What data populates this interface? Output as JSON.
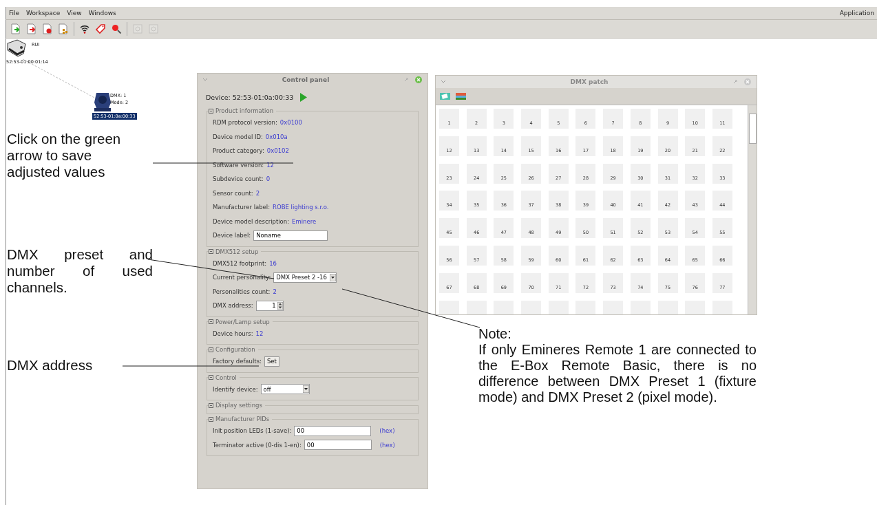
{
  "menu": [
    {
      "label": "File"
    },
    {
      "label": "Workspace"
    },
    {
      "label": "View"
    },
    {
      "label": "Windows"
    }
  ],
  "menu_right": "Application",
  "toolbar": [
    {
      "kind": "doc-in",
      "disabled": false
    },
    {
      "kind": "doc-out",
      "disabled": false
    },
    {
      "kind": "doc-remove",
      "disabled": false
    },
    {
      "kind": "doc-grid",
      "disabled": false
    },
    {
      "kind": "sep"
    },
    {
      "kind": "wifi",
      "disabled": false
    },
    {
      "kind": "tag",
      "disabled": false
    },
    {
      "kind": "search",
      "disabled": false
    },
    {
      "kind": "sep"
    },
    {
      "kind": "box",
      "disabled": true
    },
    {
      "kind": "box",
      "disabled": true
    }
  ],
  "canvas": {
    "controller": {
      "name": "RUI",
      "uid": "52:53-01:00:01:14"
    },
    "fixture": {
      "dmx": "DMX: 1",
      "mode": "Mode: 2",
      "uid": "52:53-01:0a:00:33",
      "selected": true
    }
  },
  "control_panel": {
    "title": "Control panel",
    "device": "Device: 52:53-01:0a:00:33",
    "groups": [
      {
        "title": "Product information",
        "rows": [
          {
            "kind": "value",
            "label": "RDM protocol version:",
            "value": "0x0100"
          },
          {
            "kind": "value",
            "label": "Device model ID:",
            "value": "0x010a"
          },
          {
            "kind": "value",
            "label": "Product category:",
            "value": "0x0102"
          },
          {
            "kind": "value",
            "label": "Software version:",
            "value": "12"
          },
          {
            "kind": "value",
            "label": "Subdevice count:",
            "value": "0"
          },
          {
            "kind": "value",
            "label": "Sensor count:",
            "value": "2"
          },
          {
            "kind": "value",
            "label": "Manufacturer label:",
            "value": "ROBE lighting s.r.o."
          },
          {
            "kind": "value",
            "label": "Device model description:",
            "value": "Eminere"
          },
          {
            "kind": "input",
            "label": "Device label:",
            "value": "Noname"
          }
        ]
      },
      {
        "title": "DMX512 setup",
        "rows": [
          {
            "kind": "value",
            "label": "DMX512 footprint:",
            "value": "16"
          },
          {
            "kind": "select",
            "label": "Current personality:",
            "value": "DMX Preset 2 -16"
          },
          {
            "kind": "value",
            "label": "Personalities count:",
            "value": "2"
          },
          {
            "kind": "spin",
            "label": "DMX address:",
            "value": "1"
          }
        ]
      },
      {
        "title": "Power/Lamp setup",
        "rows": [
          {
            "kind": "value",
            "label": "Device hours:",
            "value": "12"
          }
        ]
      },
      {
        "title": "Configuration",
        "rows": [
          {
            "kind": "button",
            "label": "Factory defaults:",
            "value": "Set"
          }
        ]
      },
      {
        "title": "Control",
        "rows": [
          {
            "kind": "select",
            "label": "Identify device:",
            "value": "off"
          }
        ]
      },
      {
        "title": "Display settings"
      },
      {
        "title": "Manufacturer PIDs",
        "rows": [
          {
            "kind": "hex",
            "label": "Init position LEDs (1-save):",
            "value": "00",
            "suffix": "(hex)"
          },
          {
            "kind": "hex",
            "label": "Terminator active (0-dis 1-en):",
            "value": "00",
            "suffix": "(hex)"
          }
        ]
      }
    ]
  },
  "dmx_patch": {
    "title": "DMX patch",
    "slots": [
      "1",
      "2",
      "3",
      "4",
      "5",
      "6",
      "7",
      "8",
      "9",
      "10",
      "11",
      "12",
      "13",
      "14",
      "15",
      "16",
      "17",
      "18",
      "19",
      "20",
      "21",
      "22",
      "23",
      "24",
      "25",
      "26",
      "27",
      "28",
      "29",
      "30",
      "31",
      "32",
      "33",
      "34",
      "35",
      "36",
      "37",
      "38",
      "39",
      "40",
      "41",
      "42",
      "43",
      "44",
      "45",
      "46",
      "47",
      "48",
      "49",
      "50",
      "51",
      "52",
      "53",
      "54",
      "55",
      "56",
      "57",
      "58",
      "59",
      "60",
      "61",
      "62",
      "63",
      "64",
      "65",
      "66",
      "67",
      "68",
      "69",
      "70",
      "71",
      "72",
      "73",
      "74",
      "75",
      "76",
      "77"
    ]
  },
  "annotations": [
    {
      "kind": "ragged",
      "text": "Click on the green arrow to save adjusted values"
    },
    {
      "kind": "justified",
      "text": "DMX preset and number of used channels."
    },
    {
      "kind": "ragged",
      "text": "DMX address"
    },
    {
      "kind": "note",
      "title": "Note:",
      "text": "If only Emineres Remote 1 are connected to the E-Box Remote Basic, there is no difference between DMX Preset 1 (fixture mode) and DMX Preset 2 (pixel mode)."
    }
  ]
}
